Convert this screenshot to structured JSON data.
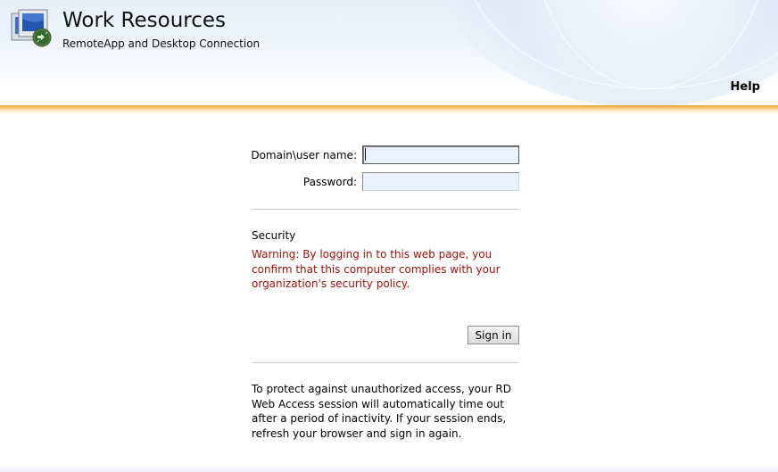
{
  "header": {
    "title": "Work Resources",
    "subtitle": "RemoteApp and Desktop Connection",
    "help_label": "Help"
  },
  "login": {
    "username_label": "Domain\\user name:",
    "username_value": "",
    "password_label": "Password:",
    "password_value": ""
  },
  "security": {
    "heading": "Security",
    "warning": "Warning: By logging in to this web page, you confirm that this computer complies with your organization's security policy."
  },
  "actions": {
    "signin_label": "Sign in"
  },
  "notice": "To protect against unauthorized access, your RD Web Access session will automatically time out after a period of inactivity. If your session ends, refresh your browser and sign in again.",
  "colors": {
    "accent_orange": "#f0a030",
    "warning_red": "#a01010",
    "input_bg": "#e8f1fc"
  },
  "icons": {
    "app": "remote-desktop-icon"
  }
}
